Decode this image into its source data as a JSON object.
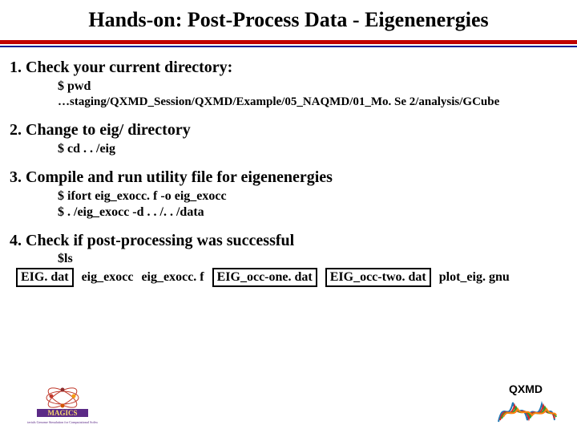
{
  "title": "Hands-on: Post-Process Data - Eigenenergies",
  "step1": {
    "head": "1. Check your current directory:",
    "cmd": "$ pwd",
    "path": "…staging/QXMD_Session/QXMD/Example/05_NAQMD/01_Mo. Se 2/analysis/GCube"
  },
  "step2": {
    "head": "2. Change to eig/ directory",
    "cmd": "$ cd . . /eig"
  },
  "step3": {
    "head": "3. Compile and run utility file for eigenenergies",
    "cmd1": "$ ifort eig_exocc. f -o eig_exocc",
    "cmd2": "$ . /eig_exocc -d . . /. . /data"
  },
  "step4": {
    "head": "4. Check if post-processing was successful",
    "ls": "$ls",
    "files": {
      "f1": "EIG. dat",
      "f2": "eig_exocc",
      "f3": "eig_exocc. f",
      "f4": "EIG_occ-one. dat",
      "f5": "EIG_occ-two. dat",
      "f6": "plot_eig. gnu"
    }
  },
  "logos": {
    "left_name": "magics-logo",
    "right_text": "QXMD"
  }
}
